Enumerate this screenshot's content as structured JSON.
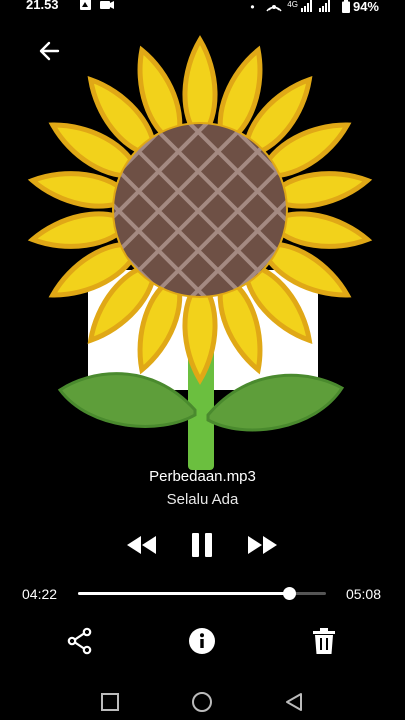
{
  "status_bar": {
    "time": "21.53",
    "network": "4G",
    "battery": "94%"
  },
  "player": {
    "title": "Perbedaan.mp3",
    "artist": "Selalu Ada",
    "current_time": "04:22",
    "total_time": "05:08",
    "progress": 0.85
  },
  "icons": {
    "back": "arrow-left-icon",
    "rewind": "rewind-icon",
    "pause": "pause-icon",
    "fast_forward": "fast-forward-icon",
    "share": "share-icon",
    "info": "info-icon",
    "delete": "trash-icon",
    "recent": "square-icon",
    "home": "circle-icon",
    "nav_back": "triangle-back-icon",
    "artwork": "sunflower-icon"
  },
  "colors": {
    "background": "#000000",
    "petal": "#F2D21B",
    "petal_edge": "#E0A816",
    "seed_center": "#6E5045",
    "stem": "#6BBF3F",
    "leaf": "#5E9E3A"
  }
}
